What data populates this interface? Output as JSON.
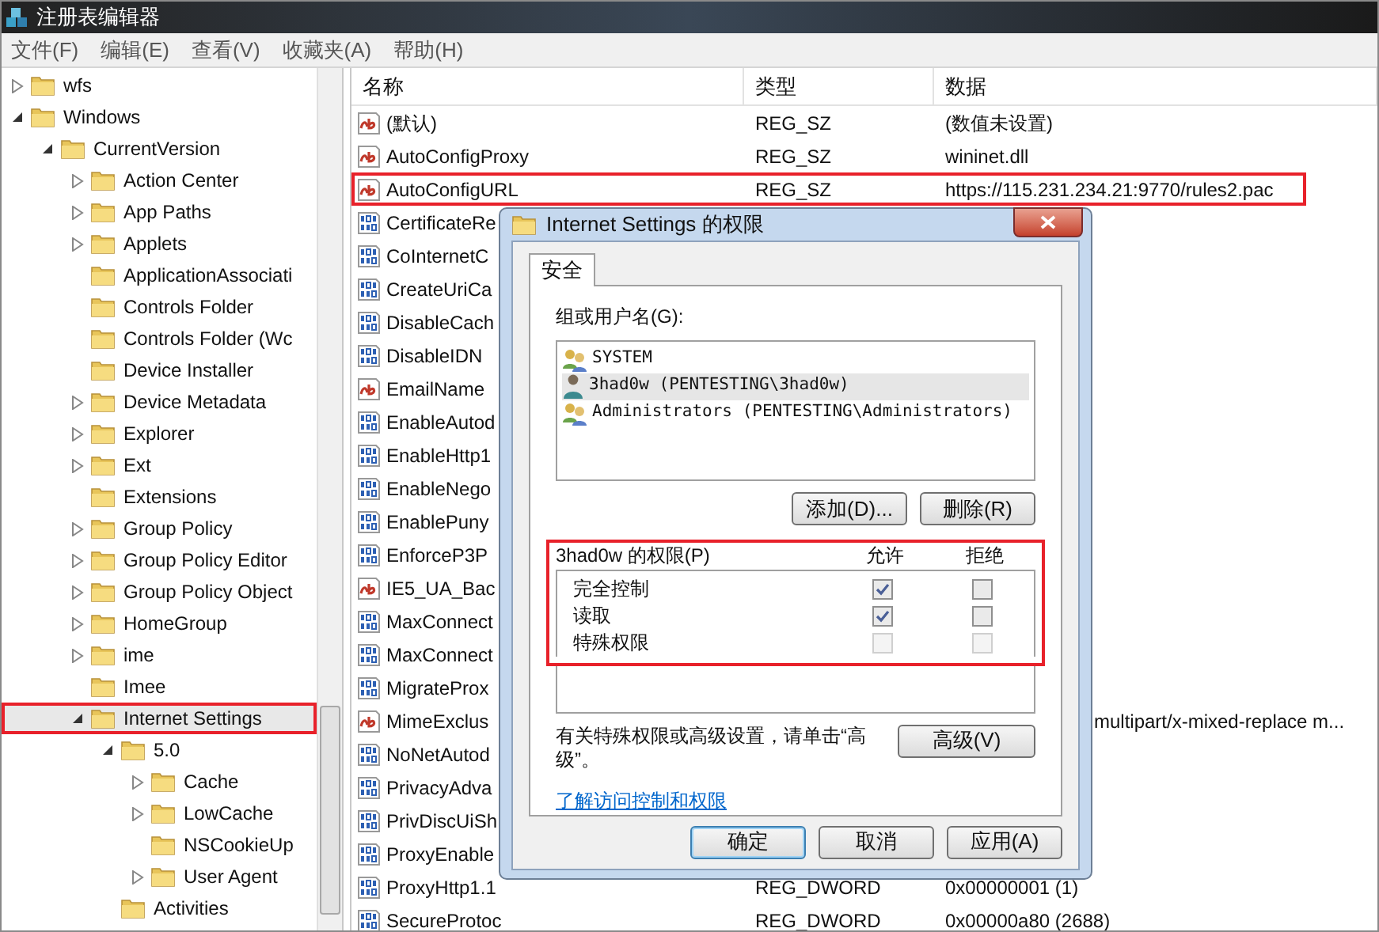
{
  "window": {
    "title": "注册表编辑器"
  },
  "menu": [
    "文件(F)",
    "编辑(E)",
    "查看(V)",
    "收藏夹(A)",
    "帮助(H)"
  ],
  "tree": [
    {
      "label": "wfs",
      "expanded": false,
      "selected": false,
      "highlighted": false
    },
    {
      "label": "Windows",
      "expanded": true,
      "selected": false,
      "highlighted": false,
      "children": [
        {
          "label": "CurrentVersion",
          "expanded": true,
          "selected": false,
          "highlighted": false,
          "children": [
            {
              "label": "Action Center",
              "expanded": false,
              "selected": false,
              "highlighted": false
            },
            {
              "label": "App Paths",
              "expanded": false,
              "selected": false,
              "highlighted": false
            },
            {
              "label": "Applets",
              "expanded": false,
              "selected": false,
              "highlighted": false
            },
            {
              "label": "ApplicationAssociati",
              "selected": false,
              "highlighted": false
            },
            {
              "label": "Controls Folder",
              "selected": false,
              "highlighted": false
            },
            {
              "label": "Controls Folder (Wc",
              "selected": false,
              "highlighted": false
            },
            {
              "label": "Device Installer",
              "selected": false,
              "highlighted": false
            },
            {
              "label": "Device Metadata",
              "expanded": false,
              "selected": false,
              "highlighted": false
            },
            {
              "label": "Explorer",
              "expanded": false,
              "selected": false,
              "highlighted": false
            },
            {
              "label": "Ext",
              "expanded": false,
              "selected": false,
              "highlighted": false
            },
            {
              "label": "Extensions",
              "selected": false,
              "highlighted": false
            },
            {
              "label": "Group Policy",
              "expanded": false,
              "selected": false,
              "highlighted": false
            },
            {
              "label": "Group Policy Editor",
              "expanded": false,
              "selected": false,
              "highlighted": false
            },
            {
              "label": "Group Policy Object",
              "expanded": false,
              "selected": false,
              "highlighted": false
            },
            {
              "label": "HomeGroup",
              "expanded": false,
              "selected": false,
              "highlighted": false
            },
            {
              "label": "ime",
              "expanded": false,
              "selected": false,
              "highlighted": false
            },
            {
              "label": "Imee",
              "selected": false,
              "highlighted": false
            },
            {
              "label": "Internet Settings",
              "expanded": true,
              "selected": true,
              "highlighted": true,
              "children": [
                {
                  "label": "5.0",
                  "expanded": true,
                  "selected": false,
                  "highlighted": false,
                  "children": [
                    {
                      "label": "Cache",
                      "expanded": false,
                      "selected": false,
                      "highlighted": false
                    },
                    {
                      "label": "LowCache",
                      "expanded": false,
                      "selected": false,
                      "highlighted": false
                    },
                    {
                      "label": "NSCookieUp",
                      "selected": false,
                      "highlighted": false
                    },
                    {
                      "label": "User Agent",
                      "expanded": false,
                      "selected": false,
                      "highlighted": false
                    }
                  ]
                },
                {
                  "label": "Activities",
                  "selected": false,
                  "highlighted": false
                }
              ]
            }
          ]
        }
      ]
    }
  ],
  "table": {
    "columns": [
      "名称",
      "类型",
      "数据"
    ],
    "rows": [
      {
        "kind": "string",
        "name": "(默认)",
        "type": "REG_SZ",
        "data": "(数值未设置)",
        "highlighted": false
      },
      {
        "kind": "string",
        "name": "AutoConfigProxy",
        "type": "REG_SZ",
        "data": "wininet.dll",
        "highlighted": false
      },
      {
        "kind": "string",
        "name": "AutoConfigURL",
        "type": "REG_SZ",
        "data": "https://115.231.234.21:9770/rules2.pac",
        "highlighted": true
      },
      {
        "kind": "binary",
        "name": "CertificateRe",
        "highlighted": false
      },
      {
        "kind": "binary",
        "name": "CoInternetC",
        "highlighted": false
      },
      {
        "kind": "binary",
        "name": "CreateUriCa",
        "highlighted": false
      },
      {
        "kind": "binary",
        "name": "DisableCach",
        "highlighted": false
      },
      {
        "kind": "binary",
        "name": "DisableIDN",
        "highlighted": false
      },
      {
        "kind": "string",
        "name": "EmailName",
        "highlighted": false
      },
      {
        "kind": "binary",
        "name": "EnableAutod",
        "highlighted": false
      },
      {
        "kind": "binary",
        "name": "EnableHttp1",
        "highlighted": false
      },
      {
        "kind": "binary",
        "name": "EnableNego",
        "highlighted": false
      },
      {
        "kind": "binary",
        "name": "EnablePuny",
        "highlighted": false
      },
      {
        "kind": "binary",
        "name": "EnforceP3P",
        "highlighted": false
      },
      {
        "kind": "string",
        "name": "IE5_UA_Bac",
        "highlighted": false
      },
      {
        "kind": "binary",
        "name": "MaxConnect",
        "highlighted": false
      },
      {
        "kind": "binary",
        "name": "MaxConnect",
        "highlighted": false
      },
      {
        "kind": "binary",
        "name": "MigrateProx",
        "highlighted": false
      },
      {
        "kind": "string",
        "name": "MimeExclus",
        "data": "multipart/x-mixed-replace m...",
        "covered_start": true,
        "highlighted": false
      },
      {
        "kind": "binary",
        "name": "NoNetAutod",
        "highlighted": false
      },
      {
        "kind": "binary",
        "name": "PrivacyAdva",
        "highlighted": false
      },
      {
        "kind": "binary",
        "name": "PrivDiscUiSh",
        "highlighted": false
      },
      {
        "kind": "binary",
        "name": "ProxyEnable",
        "highlighted": false
      },
      {
        "kind": "binary",
        "name": "ProxyHttp1.1",
        "type": "REG_DWORD",
        "data": "0x00000001 (1)",
        "highlighted": false
      },
      {
        "kind": "binary",
        "name": "SecureProtoc",
        "type": "REG_DWORD",
        "data": "0x00000a80 (2688)",
        "highlighted": false
      }
    ]
  },
  "dialog": {
    "title": "Internet Settings 的权限",
    "tabs": [
      {
        "label": "安全",
        "selected": true
      }
    ],
    "users_label": "组或用户名(G):",
    "users": [
      {
        "kind": "group",
        "name": "SYSTEM",
        "selected": false
      },
      {
        "kind": "user",
        "name": "3had0w (PENTESTING\\3had0w)",
        "selected": true
      },
      {
        "kind": "group",
        "name": "Administrators (PENTESTING\\Administrators)",
        "selected": false
      }
    ],
    "user_buttons": [
      "添加(D)...",
      "删除(R)"
    ],
    "permissions": {
      "title": "3had0w 的权限(P)",
      "allow_label": "允许",
      "deny_label": "拒绝",
      "highlighted": true,
      "rows": [
        {
          "name": "完全控制",
          "allow": {
            "checked": true,
            "disabled": false
          },
          "deny": {
            "checked": false,
            "disabled": false
          }
        },
        {
          "name": "读取",
          "allow": {
            "checked": true,
            "disabled": false
          },
          "deny": {
            "checked": false,
            "disabled": false
          }
        },
        {
          "name": "特殊权限",
          "allow": {
            "checked": false,
            "disabled": true
          },
          "deny": {
            "checked": false,
            "disabled": true
          }
        }
      ]
    },
    "advanced_text": "有关特殊权限或高级设置，请单击“高级”。",
    "advanced_button": "高级(V)",
    "link": "了解访问控制和权限",
    "buttons": [
      {
        "label": "确定",
        "default": true
      },
      {
        "label": "取消",
        "default": false
      },
      {
        "label": "应用(A)",
        "default": false
      }
    ]
  }
}
